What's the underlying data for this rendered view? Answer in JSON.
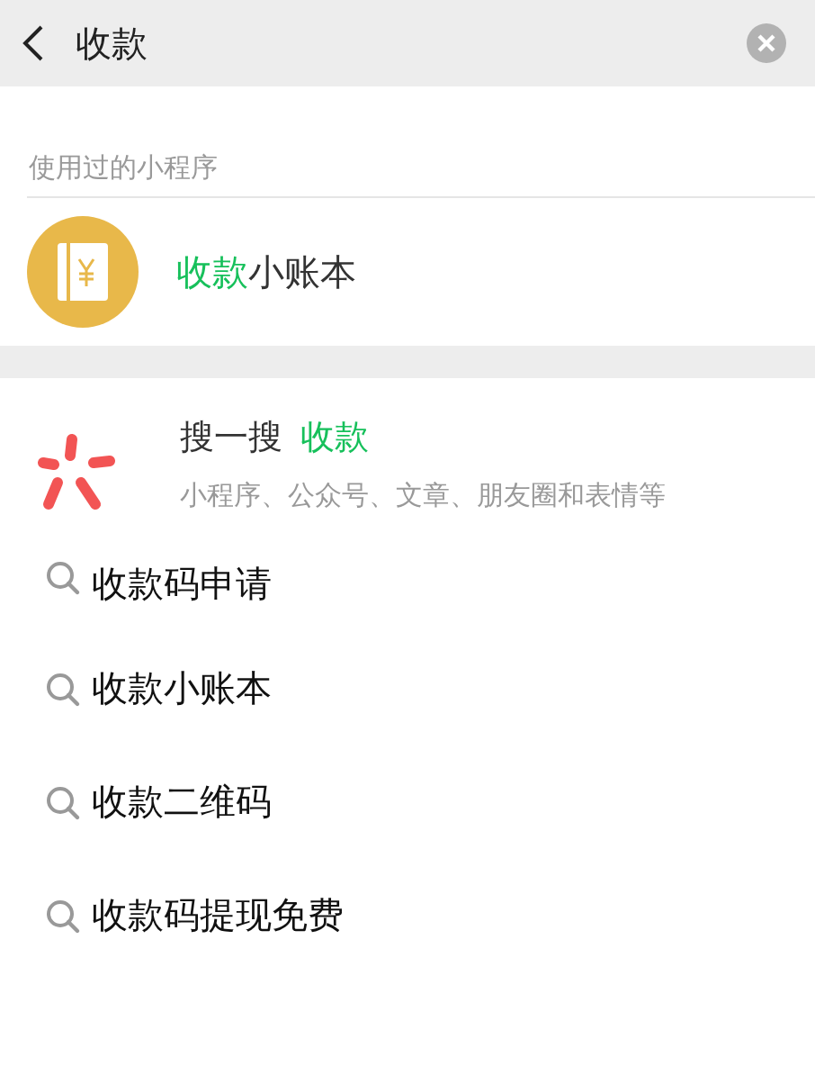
{
  "search_bar": {
    "value": "收款"
  },
  "used_mini_programs": {
    "header": "使用过的小程序",
    "items": [
      {
        "highlight": "收款",
        "rest": "小账本"
      }
    ]
  },
  "sousou": {
    "label": "搜一搜",
    "query": "收款",
    "subtitle": "小程序、公众号、文章、朋友圈和表情等"
  },
  "suggestions": [
    "收款码申请",
    "收款小账本",
    "收款二维码",
    "收款码提现免费"
  ]
}
